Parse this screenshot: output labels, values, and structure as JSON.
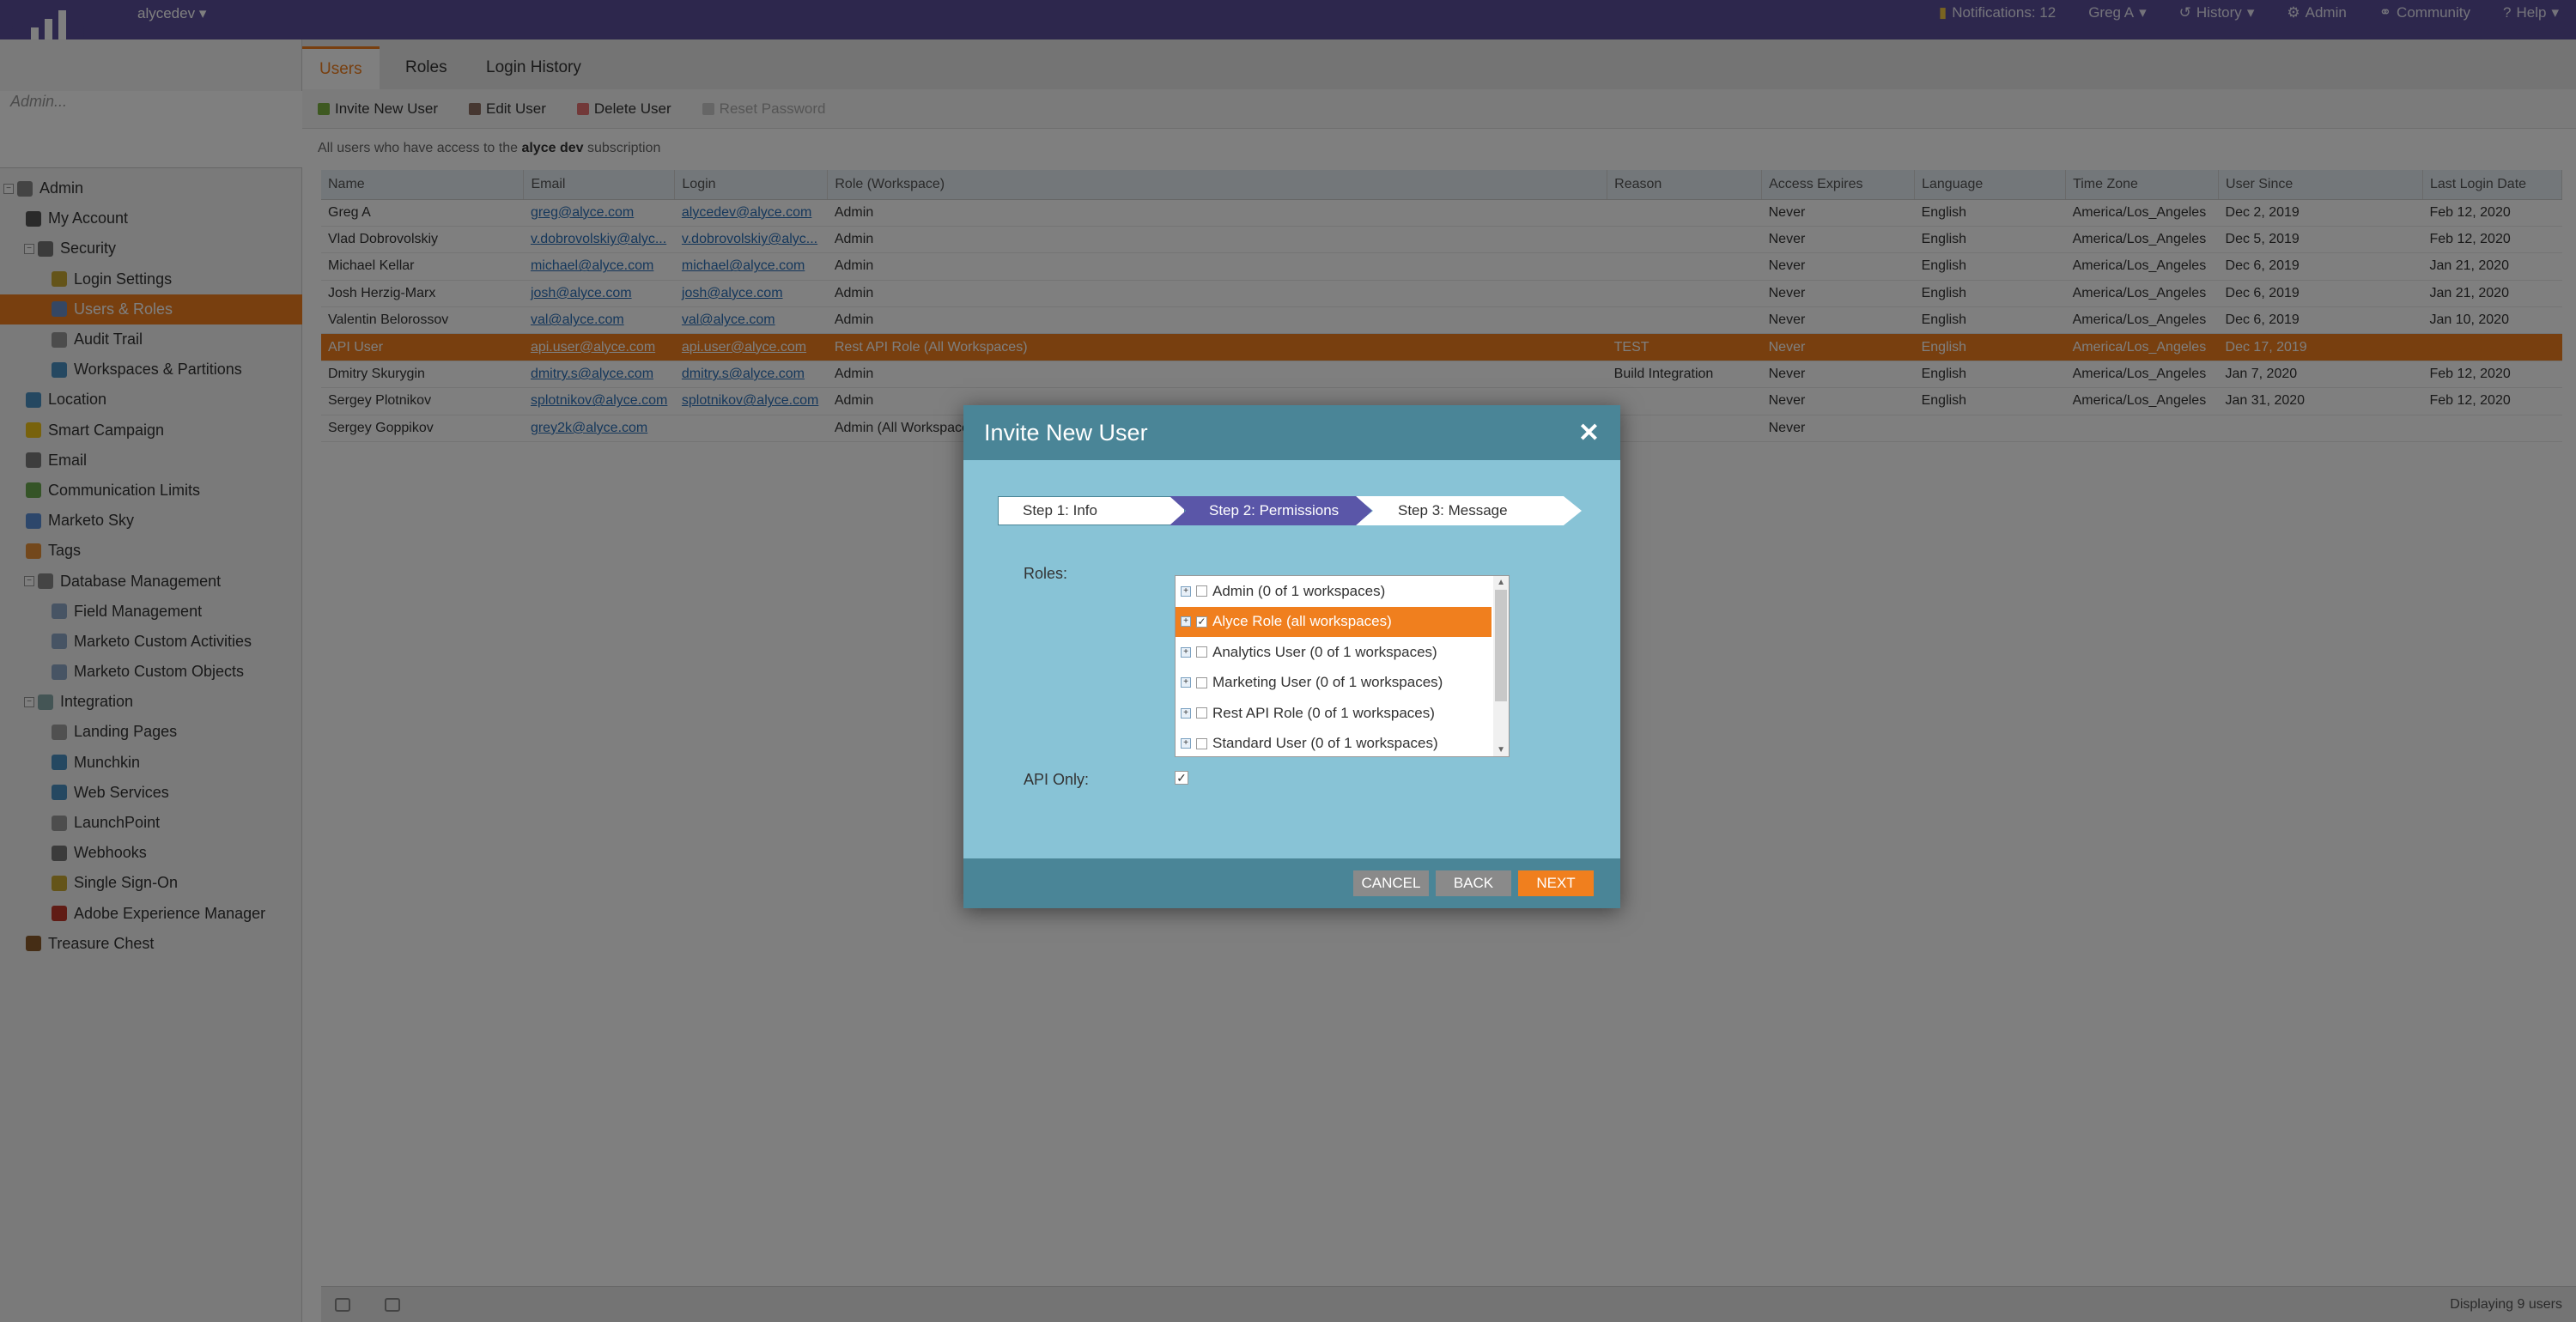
{
  "topbar": {
    "workspace": "alycedev",
    "notifications": "Notifications: 12",
    "user": "Greg A",
    "history": "History",
    "admin": "Admin",
    "community": "Community",
    "help": "Help"
  },
  "sidebar": {
    "search_placeholder": "Admin...",
    "items": [
      {
        "label": "Admin",
        "level": 0,
        "icon": "gear-icon"
      },
      {
        "label": "My Account",
        "level": 1,
        "icon": "person-icon"
      },
      {
        "label": "Security",
        "level": 1,
        "icon": "lock-icon"
      },
      {
        "label": "Login Settings",
        "level": 2,
        "icon": "key-icon"
      },
      {
        "label": "Users & Roles",
        "level": 2,
        "icon": "users-icon"
      },
      {
        "label": "Audit Trail",
        "level": 2,
        "icon": "tool-icon"
      },
      {
        "label": "Workspaces & Partitions",
        "level": 2,
        "icon": "globe-icon"
      },
      {
        "label": "Location",
        "level": 1,
        "icon": "globe-icon"
      },
      {
        "label": "Smart Campaign",
        "level": 1,
        "icon": "bulb-icon"
      },
      {
        "label": "Email",
        "level": 1,
        "icon": "email-icon"
      },
      {
        "label": "Communication Limits",
        "level": 1,
        "icon": "chart-icon"
      },
      {
        "label": "Marketo Sky",
        "level": 1,
        "icon": "plane-icon"
      },
      {
        "label": "Tags",
        "level": 1,
        "icon": "tag-icon"
      },
      {
        "label": "Database Management",
        "level": 1,
        "icon": "database-icon"
      },
      {
        "label": "Field Management",
        "level": 2,
        "icon": "field-icon"
      },
      {
        "label": "Marketo Custom Activities",
        "level": 2,
        "icon": "field-icon"
      },
      {
        "label": "Marketo Custom Objects",
        "level": 2,
        "icon": "field-icon"
      },
      {
        "label": "Integration",
        "level": 1,
        "icon": "cloud-icon"
      },
      {
        "label": "Landing Pages",
        "level": 2,
        "icon": "page-icon"
      },
      {
        "label": "Munchkin",
        "level": 2,
        "icon": "munchkin-icon"
      },
      {
        "label": "Web Services",
        "level": 2,
        "icon": "globe-icon"
      },
      {
        "label": "LaunchPoint",
        "level": 2,
        "icon": "rocket-icon"
      },
      {
        "label": "Webhooks",
        "level": 2,
        "icon": "webhook-icon"
      },
      {
        "label": "Single Sign-On",
        "level": 2,
        "icon": "key-icon"
      },
      {
        "label": "Adobe Experience Manager",
        "level": 2,
        "icon": "adobe-icon"
      },
      {
        "label": "Treasure Chest",
        "level": 1,
        "icon": "chest-icon"
      }
    ],
    "selected_label": "Users & Roles"
  },
  "tabs": [
    {
      "label": "Users",
      "active": true
    },
    {
      "label": "Roles",
      "active": false
    },
    {
      "label": "Login History",
      "active": false
    }
  ],
  "toolbar": {
    "invite": "Invite New User",
    "edit": "Edit User",
    "delete": "Delete User",
    "reset": "Reset Password"
  },
  "subtitle": {
    "prefix": "All users who have access to the ",
    "bold": "alyce dev",
    "suffix": " subscription"
  },
  "table": {
    "columns": [
      "Name",
      "Email",
      "Login",
      "Role (Workspace)",
      "Reason",
      "Access Expires",
      "Language",
      "Time Zone",
      "User Since",
      "Last Login Date"
    ],
    "rows": [
      [
        "Greg A",
        "greg@alyce.com",
        "alycedev@alyce.com",
        "Admin",
        "",
        "Never",
        "English",
        "America/Los_Angeles",
        "Dec 2, 2019",
        "Feb 12, 2020"
      ],
      [
        "Vlad Dobrovolskiy",
        "v.dobrovolskiy@alyc...",
        "v.dobrovolskiy@alyc...",
        "Admin",
        "",
        "Never",
        "English",
        "America/Los_Angeles",
        "Dec 5, 2019",
        "Feb 12, 2020"
      ],
      [
        "Michael Kellar",
        "michael@alyce.com",
        "michael@alyce.com",
        "Admin",
        "",
        "Never",
        "English",
        "America/Los_Angeles",
        "Dec 6, 2019",
        "Jan 21, 2020"
      ],
      [
        "Josh Herzig-Marx",
        "josh@alyce.com",
        "josh@alyce.com",
        "Admin",
        "",
        "Never",
        "English",
        "America/Los_Angeles",
        "Dec 6, 2019",
        "Jan 21, 2020"
      ],
      [
        "Valentin Belorossov",
        "val@alyce.com",
        "val@alyce.com",
        "Admin",
        "",
        "Never",
        "English",
        "America/Los_Angeles",
        "Dec 6, 2019",
        "Jan 10, 2020"
      ],
      [
        "API User",
        "api.user@alyce.com",
        "api.user@alyce.com",
        "Rest API Role (All Workspaces)",
        "TEST",
        "Never",
        "English",
        "America/Los_Angeles",
        "Dec 17, 2019",
        ""
      ],
      [
        "Dmitry Skurygin",
        "dmitry.s@alyce.com",
        "dmitry.s@alyce.com",
        "Admin",
        "Build Integration",
        "Never",
        "English",
        "America/Los_Angeles",
        "Jan 7, 2020",
        "Feb 12, 2020"
      ],
      [
        "Sergey Plotnikov",
        "splotnikov@alyce.com",
        "splotnikov@alyce.com",
        "Admin",
        "",
        "Never",
        "English",
        "America/Los_Angeles",
        "Jan 31, 2020",
        "Feb 12, 2020"
      ],
      [
        "Sergey Goppikov",
        "grey2k@alyce.com",
        "",
        "Admin (All Workspaces)",
        "",
        "Never",
        "",
        "",
        "",
        ""
      ]
    ],
    "selected_row": 5
  },
  "statusbar": {
    "count": "Displaying 9 users"
  },
  "modal": {
    "title": "Invite New User",
    "steps": [
      "Step 1: Info",
      "Step 2: Permissions",
      "Step 3: Message"
    ],
    "roles_label": "Roles:",
    "api_only_label": "API Only:",
    "api_only_checked": true,
    "roles": [
      {
        "label": "Admin (0 of 1 workspaces)",
        "checked": false,
        "selected": false
      },
      {
        "label": "Alyce Role (all workspaces)",
        "checked": true,
        "selected": true
      },
      {
        "label": "Analytics User (0 of 1 workspaces)",
        "checked": false,
        "selected": false
      },
      {
        "label": "Marketing User (0 of 1 workspaces)",
        "checked": false,
        "selected": false
      },
      {
        "label": "Rest API Role (0 of 1 workspaces)",
        "checked": false,
        "selected": false
      },
      {
        "label": "Standard User (0 of 1 workspaces)",
        "checked": false,
        "selected": false
      }
    ],
    "buttons": {
      "cancel": "CANCEL",
      "back": "BACK",
      "next": "NEXT"
    }
  },
  "colors": {
    "brand": "#5a4f9a",
    "accent": "#f07f1e",
    "modal_header": "#4a8597",
    "modal_body": "#88c3d6",
    "step_active": "#5a56a8"
  }
}
